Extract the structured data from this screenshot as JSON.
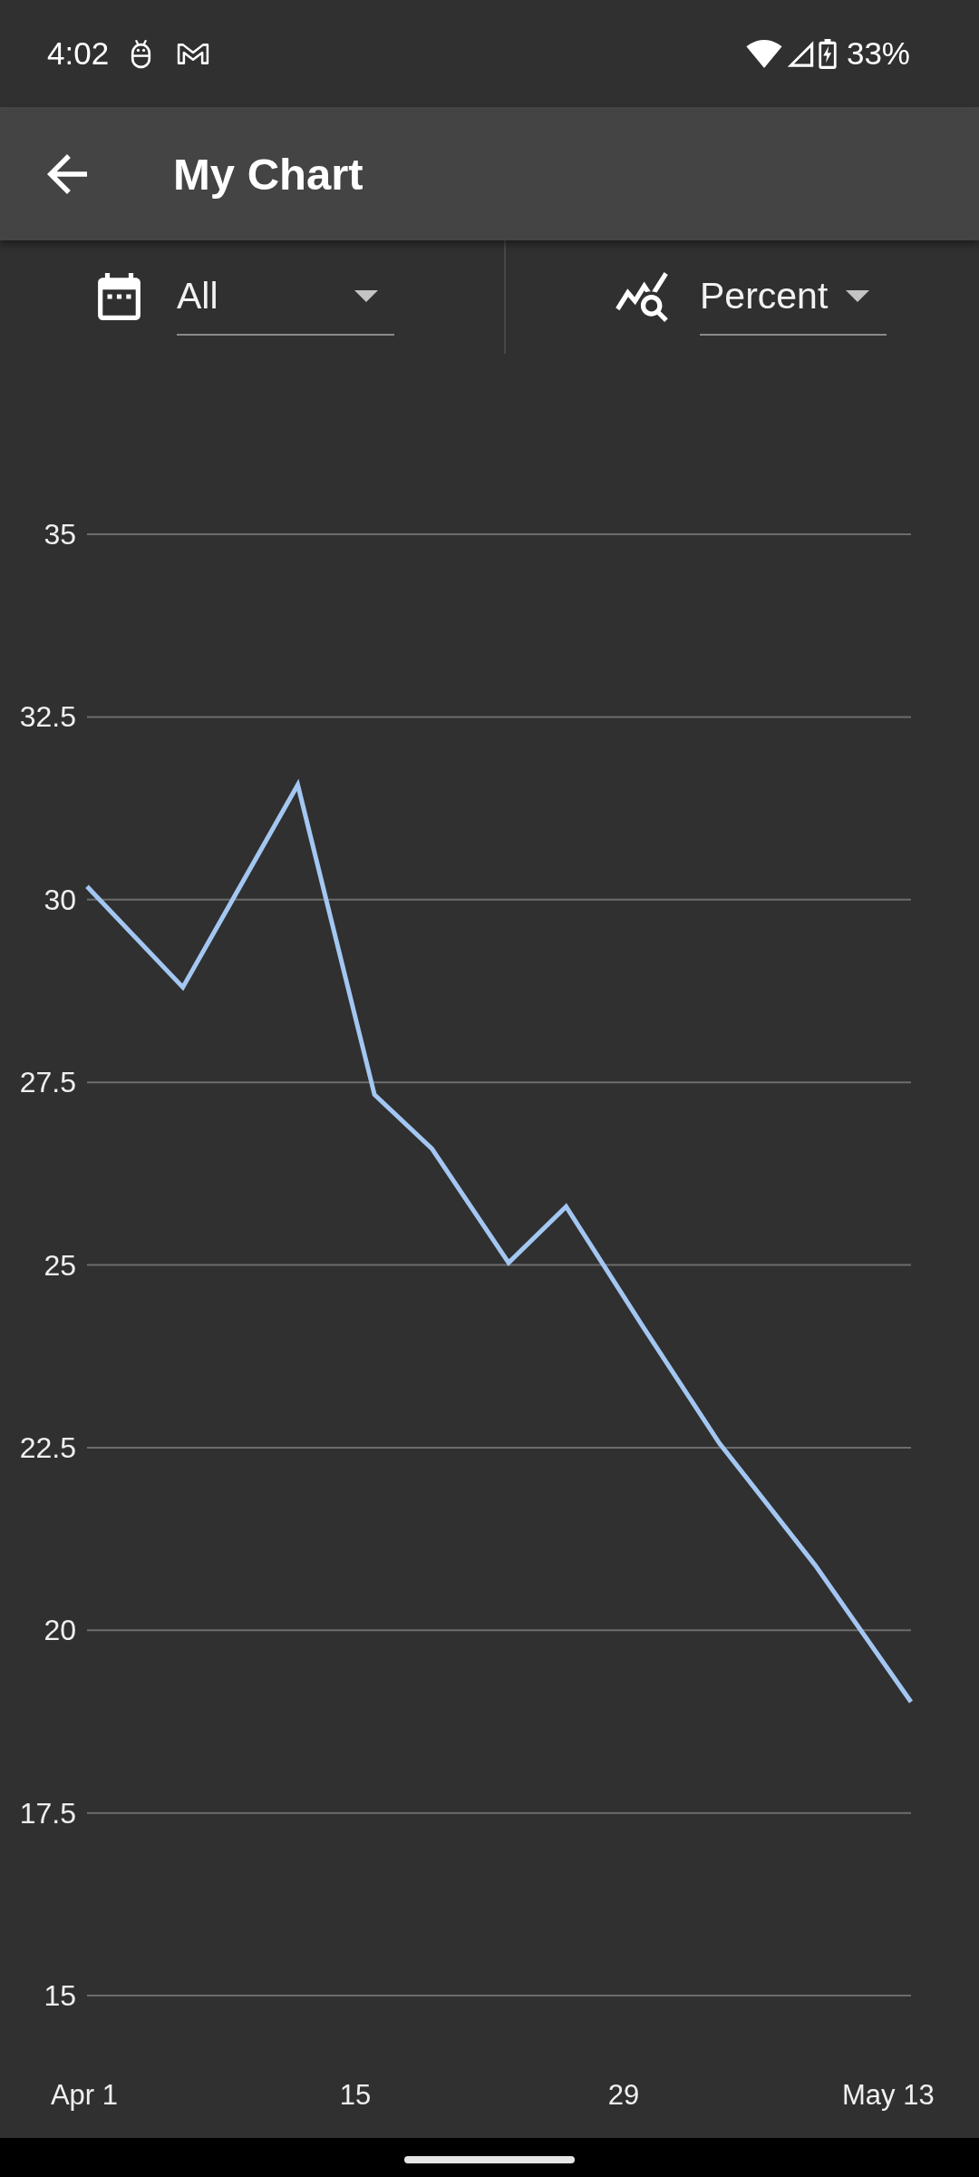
{
  "status_bar": {
    "time": "4:02",
    "battery": "33%"
  },
  "app_bar": {
    "title": "My Chart"
  },
  "filters": [
    {
      "kind": "date_range",
      "value": "All"
    },
    {
      "kind": "metric",
      "value": "Percent"
    }
  ],
  "chart": {
    "chart_data": {
      "type": "line",
      "x": [
        1,
        6,
        12,
        16,
        19,
        23,
        26,
        30,
        34,
        39,
        44
      ],
      "values": [
        30.18,
        28.8,
        31.57,
        27.33,
        26.59,
        25.03,
        25.8,
        24.16,
        22.56,
        20.89,
        19.02
      ],
      "xlim": [
        1,
        44
      ],
      "ylim": [
        15,
        35
      ],
      "xticks": [
        {
          "value": 1,
          "label": "Apr 1"
        },
        15,
        29,
        {
          "value": 43,
          "label": "May 13"
        }
      ],
      "yticks": [
        15,
        17.5,
        20,
        22.5,
        25,
        27.5,
        30,
        32.5,
        35
      ],
      "grid": true
    }
  }
}
